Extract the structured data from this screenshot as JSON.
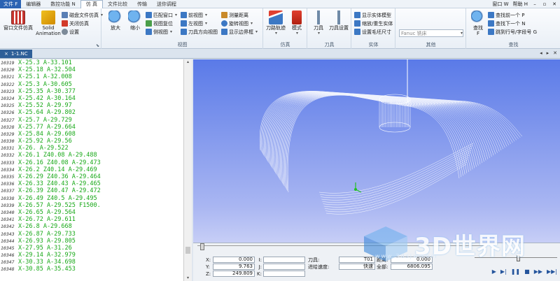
{
  "menubar": {
    "file": "文件 F",
    "tabs": [
      "编辑器",
      "数控功能 N",
      "仿 真",
      "文件比较",
      "传输",
      "送你调程"
    ],
    "active_tab": "仿 真",
    "right_items": [
      "窗口 W",
      "帮助 H"
    ]
  },
  "ribbon": {
    "win_sim": "窗口文件仿真",
    "solid_anim": [
      "Solid",
      "Animation"
    ],
    "disk_sim": "磁盘文件仿真",
    "close_sim": "关闭仿真",
    "settings": "设置",
    "zoom_in": "放大",
    "zoom_out": "缩小",
    "fit_window": "匹配窗口",
    "view_reset": "视图复位",
    "side_view": "侧视图",
    "front_view": "前视图",
    "left_view": "左视图",
    "tool_view": "刀具方向视图",
    "measure": "测量距离",
    "rotate": "旋转视图",
    "show_bounds": "显示边界框",
    "view_group": "视图",
    "tool_path": "刀路轨迹",
    "mode": "模式",
    "sim_group": "仿真",
    "tool": "刀具",
    "tool_settings": "刀具设置",
    "tool_group": "刀具",
    "show_solid": "显示实体模型",
    "cut_solid": "缩放/重生实体",
    "blank_size": "设置毛坯尺寸",
    "solid_group": "实体",
    "machine": "Fanuc 铣床",
    "other_group": "其他",
    "find": "查找",
    "find_prev": "查找前一个 P",
    "find_next": "查找下一个 N",
    "goto_line": "跳到行号/字段号 G",
    "find_group": "查找"
  },
  "tabstrip": {
    "doc_name": "1-1.NC",
    "close": "×"
  },
  "code": [
    {
      "n": "10319",
      "t": "X-25.3 A-33.101"
    },
    {
      "n": "10320",
      "t": "X-25.18 A-32.504"
    },
    {
      "n": "10321",
      "t": "X-25.1 A-32.008"
    },
    {
      "n": "10322",
      "t": "X-25.3 A-30.605"
    },
    {
      "n": "10323",
      "t": "X-25.35 A-30.377"
    },
    {
      "n": "10324",
      "t": "X-25.42 A-30.164"
    },
    {
      "n": "10325",
      "t": "X-25.52 A-29.97"
    },
    {
      "n": "10326",
      "t": "X-25.64 A-29.802"
    },
    {
      "n": "10327",
      "t": "X-25.7 A-29.729"
    },
    {
      "n": "10328",
      "t": "X-25.77 A-29.664"
    },
    {
      "n": "10329",
      "t": "X-25.84 A-29.608"
    },
    {
      "n": "10330",
      "t": "X-25.92 A-29.56"
    },
    {
      "n": "10331",
      "t": "X-26. A-29.522"
    },
    {
      "n": "10332",
      "t": "X-26.1 Z40.08 A-29.488"
    },
    {
      "n": "10333",
      "t": "X-26.16 Z40.08 A-29.473"
    },
    {
      "n": "10334",
      "t": "X-26.2 Z40.14 A-29.469"
    },
    {
      "n": "10335",
      "t": "X-26.29 Z40.36 A-29.464"
    },
    {
      "n": "10336",
      "t": "X-26.33 Z40.43 A-29.465"
    },
    {
      "n": "10337",
      "t": "X-26.39 Z40.47 A-29.472"
    },
    {
      "n": "10338",
      "t": "X-26.49 Z40.5 A-29.495"
    },
    {
      "n": "10339",
      "t": "X-26.57 A-29.525 F1500."
    },
    {
      "n": "10340",
      "t": "X-26.65 A-29.564"
    },
    {
      "n": "10341",
      "t": "X-26.72 A-29.611"
    },
    {
      "n": "10342",
      "t": "X-26.8 A-29.668"
    },
    {
      "n": "10343",
      "t": "X-26.87 A-29.733"
    },
    {
      "n": "10344",
      "t": "X-26.93 A-29.805"
    },
    {
      "n": "10345",
      "t": "X-27.95 A-31.26"
    },
    {
      "n": "10346",
      "t": "X-29.14 A-32.979"
    },
    {
      "n": "10347",
      "t": "X-30.33 A-34.698"
    },
    {
      "n": "10348",
      "t": "X-30.85 A-35.453"
    }
  ],
  "status": {
    "x_label": "X:",
    "x_val": "0.000",
    "y_label": "Y:",
    "y_val": "9.763",
    "z_label": "Z:",
    "z_val": "249.809",
    "i_label": "I:",
    "j_label": "J:",
    "k_label": "K:",
    "tool_label": "刀具:",
    "tool_val": "T01",
    "feed_label": "进给速度:",
    "feed_val": "快速",
    "dist_label": "距离:",
    "dist_val": "0.000",
    "total_label": "全部:",
    "total_val": "6806.095"
  },
  "watermark": {
    "text": "3D世界网",
    "sub": "www.3dsjw.com"
  },
  "colors": {
    "code_green": "#17a817",
    "viewport_top": "#5a7ae8",
    "viewport_bottom": "#c7cef6",
    "file_tab": "#2b63b3"
  }
}
